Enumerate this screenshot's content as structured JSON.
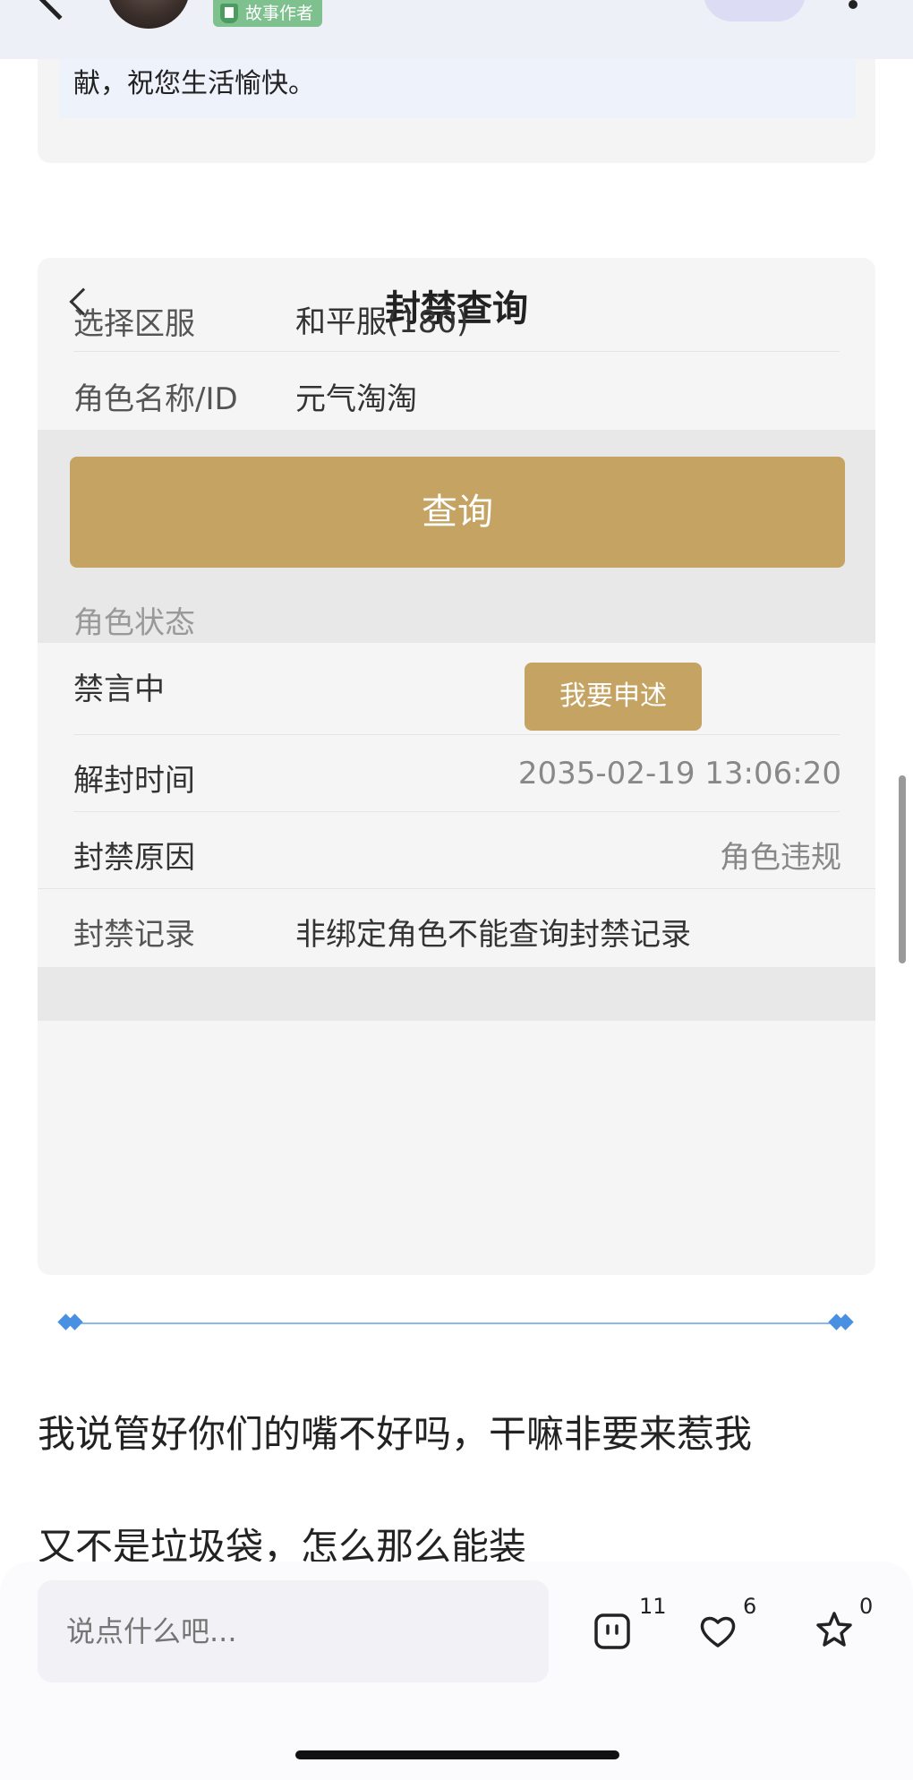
{
  "topbar": {
    "badge_label": "故事作者"
  },
  "previous_note": "献，祝您生活愉快。",
  "ban_query": {
    "title": "封禁查询",
    "server_label": "选择区服",
    "server_value": "和平服(180)",
    "role_label": "角色名称/ID",
    "role_value": "元气淘淘",
    "query_button": "查询",
    "status_header": "角色状态",
    "status_value": "禁言中",
    "appeal_button": "我要申述",
    "unban_label": "解封时间",
    "unban_value": "2035-02-19 13:06:20",
    "reason_label": "封禁原因",
    "reason_value": "角色违规",
    "record_label": "封禁记录",
    "record_value": "非绑定角色不能查询封禁记录"
  },
  "post": {
    "line1": "我说管好你们的嘴不好吗，干嘛非要来惹我",
    "line2": "又不是垃圾袋，怎么那么能装"
  },
  "bottom_bar": {
    "comment_placeholder": "说点什么吧...",
    "comment_count": "11",
    "like_count": "6",
    "favorite_count": "0"
  },
  "colors": {
    "accent_gold": "#c5a363",
    "separator_blue": "#4a90e2"
  }
}
